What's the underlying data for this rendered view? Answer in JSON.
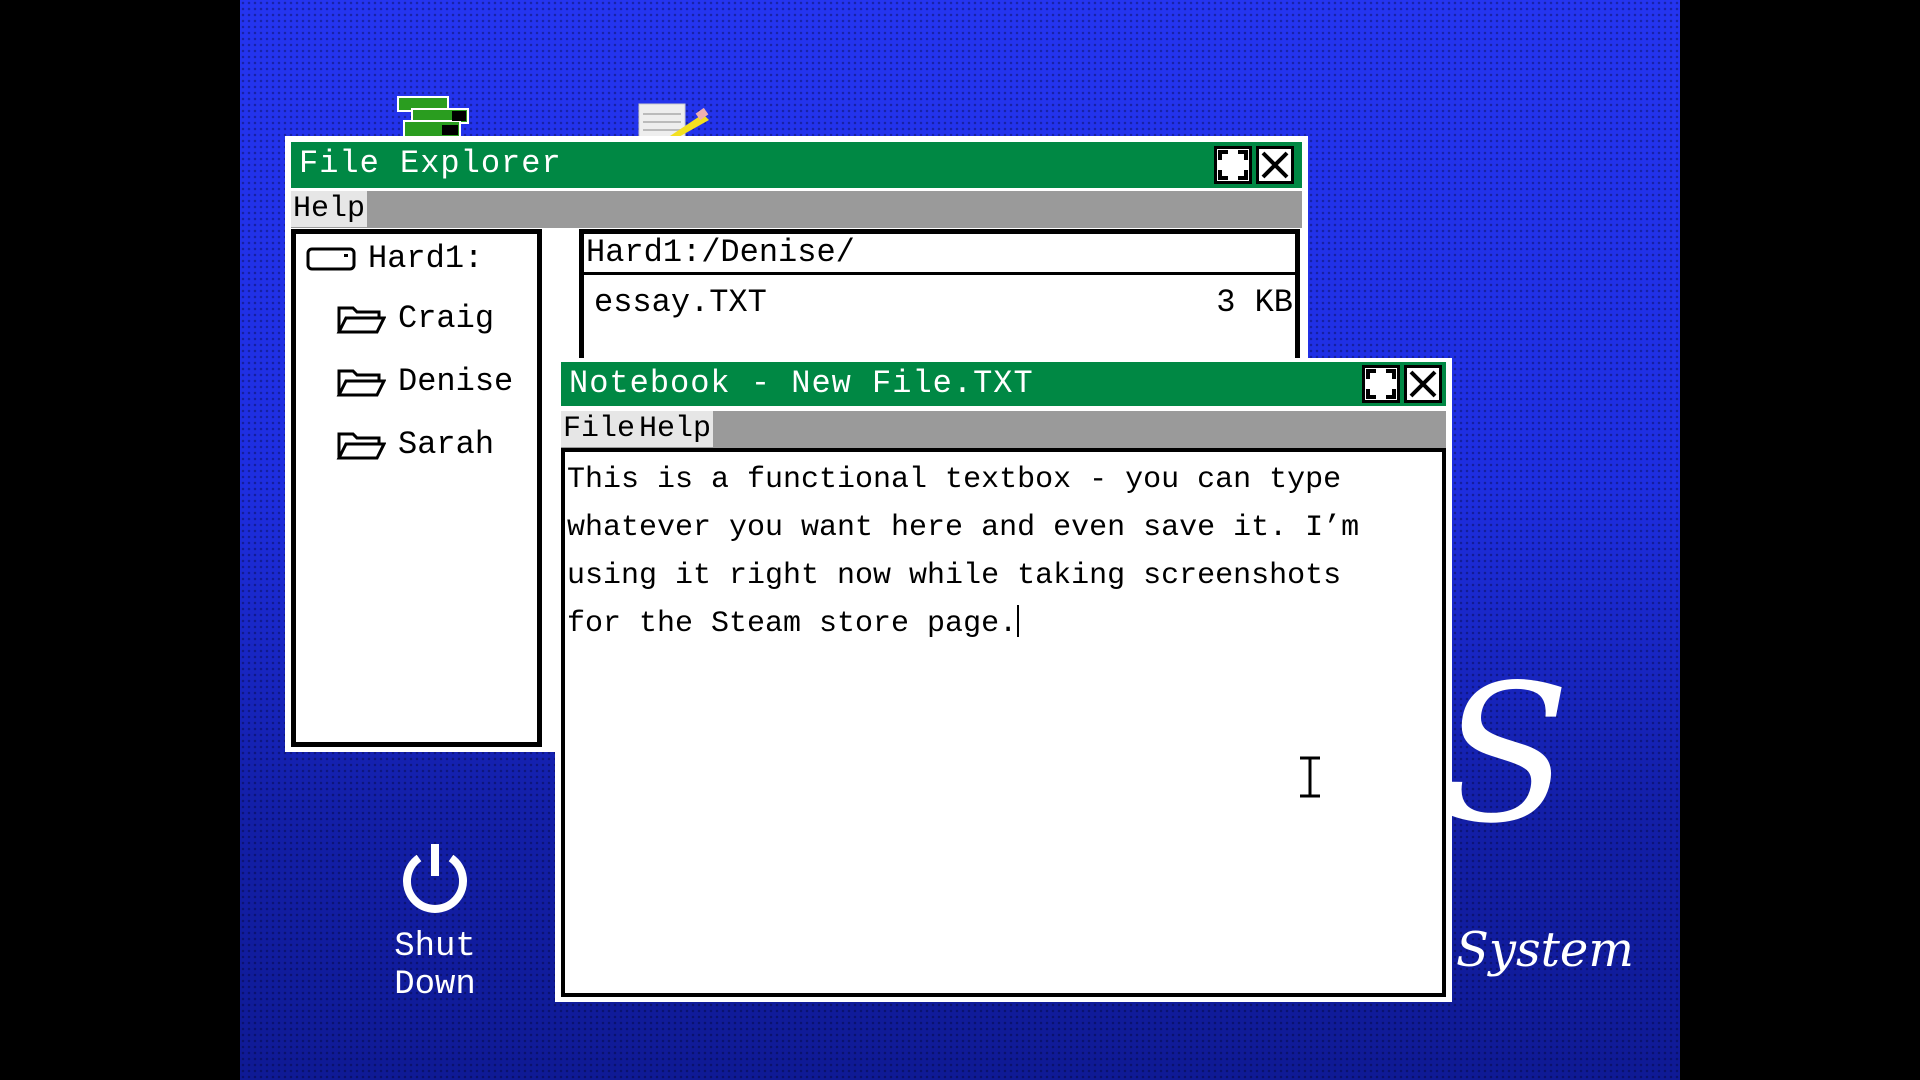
{
  "desktop": {
    "icons": [
      {
        "name": "file-explorer-icon"
      },
      {
        "name": "notebook-icon"
      }
    ],
    "shutdown_label": "Shut Down",
    "logo_letter": "S",
    "logo_word": "System",
    "background_color": "#1e2ee0"
  },
  "file_explorer": {
    "title": "File Explorer",
    "menu": [
      "Help"
    ],
    "tree": {
      "root": "Hard1:",
      "folders": [
        "Craig",
        "Denise",
        "Sarah"
      ]
    },
    "path": "Hard1:/Denise/",
    "files": [
      {
        "name": "essay.TXT",
        "size": "3 KB"
      }
    ],
    "title_color": "#008844"
  },
  "notebook": {
    "title": "Notebook - New File.TXT",
    "menu": [
      "File",
      "Help"
    ],
    "content": "This is a functional textbox - you can type\nwhatever you want here and even save it. I’m\nusing it right now while taking screenshots\nfor the Steam store page."
  }
}
